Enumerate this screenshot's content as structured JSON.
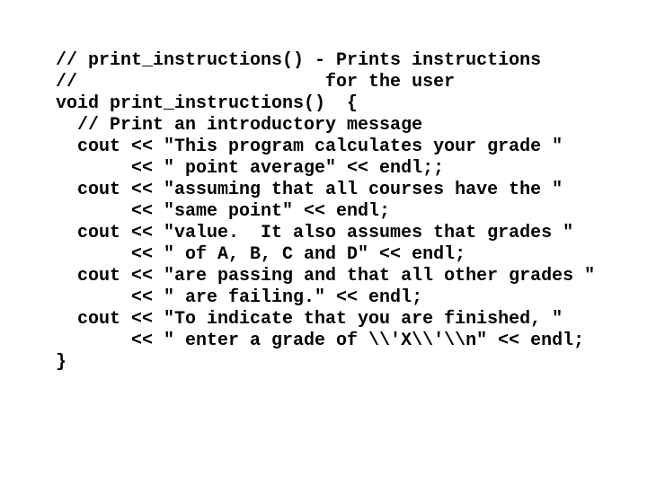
{
  "code": {
    "language": "C++",
    "lines": [
      "// print_instructions() - Prints instructions",
      "//                       for the user",
      "void print_instructions()  {",
      "  // Print an introductory message",
      "  cout << \"This program calculates your grade \"",
      "       << \" point average\" << endl;;",
      "  cout << \"assuming that all courses have the \"",
      "       << \"same point\" << endl;",
      "  cout << \"value.  It also assumes that grades \"",
      "       << \" of A, B, C and D\" << endl;",
      "  cout << \"are passing and that all other grades \"",
      "       << \" are failing.\" << endl;",
      "  cout << \"To indicate that you are finished, \"",
      "       << \" enter a grade of \\\\'X\\\\'\\\\n\" << endl;",
      "}"
    ]
  },
  "colors": {
    "background": "#ffffff",
    "text": "#000000"
  }
}
